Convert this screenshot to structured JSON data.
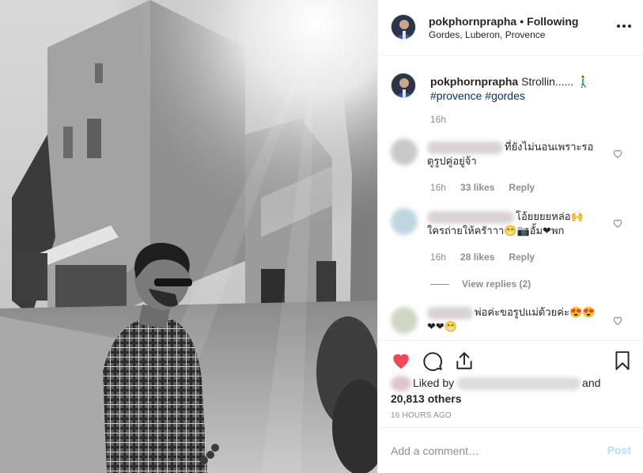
{
  "header": {
    "username": "pokphornprapha",
    "separator": "•",
    "follow_status": "Following",
    "location": "Gordes, Luberon, Provence",
    "more_icon": "more-options-icon"
  },
  "caption": {
    "username": "pokphornprapha",
    "text": "Strollin...... 🚶‍♂",
    "hashtags": [
      "#provence",
      "#gordes"
    ],
    "time": "16h"
  },
  "comments": [
    {
      "text_line1": "ที่ยังไม่นอนเพราะรอ",
      "text_line2": "ดูรูปคู่อยู่จ้า",
      "time": "16h",
      "likes": "33 likes",
      "reply": "Reply",
      "avatar_color": "#c9c9c9"
    },
    {
      "text_line1": "โอ้ยยยยหล่อ🙌",
      "text_line2": "ใครถ่ายให้ครัาาา😁📷อั้ม❤พก",
      "time": "16h",
      "likes": "28 likes",
      "reply": "Reply",
      "avatar_color": "#bfd6e2",
      "view_replies": "View replies (2)"
    },
    {
      "text_line1": "พ่อค่ะขอรูปแม่ด้วยค่ะ😍😍",
      "text_line2": "❤❤😁",
      "avatar_color": "#cdd8c4"
    }
  ],
  "actions": {
    "like_icon": "heart-filled-icon",
    "comment_icon": "comment-icon",
    "share_icon": "share-icon",
    "save_icon": "bookmark-icon",
    "liked_by_prefix": "Liked by",
    "liked_by_and": "and",
    "likes_count": "20,813 others",
    "post_time": "16 HOURS AGO",
    "accent": "#ed4956"
  },
  "add_comment": {
    "placeholder": "Add a comment…",
    "post_label": "Post",
    "post_color": "#b2dffc"
  }
}
